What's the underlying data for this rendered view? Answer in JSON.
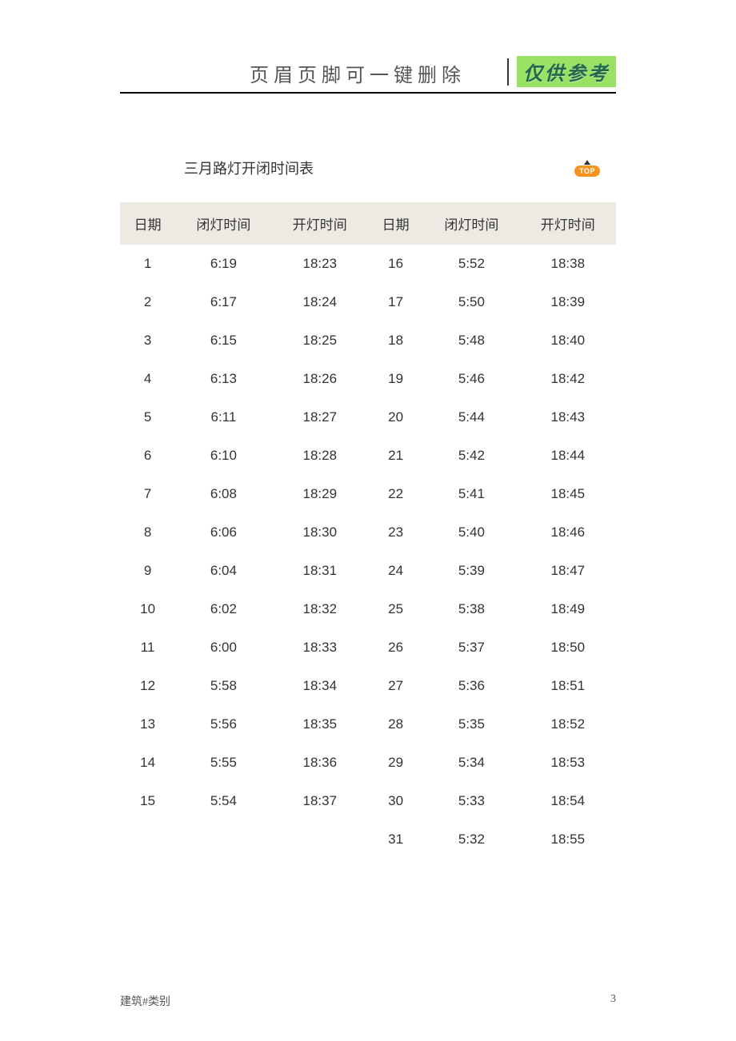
{
  "header": {
    "title": "页眉页脚可一键删除",
    "badge": "仅供参考"
  },
  "heading": "三月路灯开闭时间表",
  "top_icon_label": "TOP",
  "columns": {
    "date_a": "日期",
    "off_a": "闭灯时间",
    "on_a": "开灯时间",
    "date_b": "日期",
    "off_b": "闭灯时间",
    "on_b": "开灯时间"
  },
  "footer": {
    "left": "建筑#类别",
    "right": "3"
  },
  "chart_data": {
    "type": "table",
    "title": "三月路灯开闭时间表",
    "columns": [
      "日期",
      "闭灯时间",
      "开灯时间",
      "日期",
      "闭灯时间",
      "开灯时间"
    ],
    "rows": [
      [
        "1",
        "6:19",
        "18:23",
        "16",
        "5:52",
        "18:38"
      ],
      [
        "2",
        "6:17",
        "18:24",
        "17",
        "5:50",
        "18:39"
      ],
      [
        "3",
        "6:15",
        "18:25",
        "18",
        "5:48",
        "18:40"
      ],
      [
        "4",
        "6:13",
        "18:26",
        "19",
        "5:46",
        "18:42"
      ],
      [
        "5",
        "6:11",
        "18:27",
        "20",
        "5:44",
        "18:43"
      ],
      [
        "6",
        "6:10",
        "18:28",
        "21",
        "5:42",
        "18:44"
      ],
      [
        "7",
        "6:08",
        "18:29",
        "22",
        "5:41",
        "18:45"
      ],
      [
        "8",
        "6:06",
        "18:30",
        "23",
        "5:40",
        "18:46"
      ],
      [
        "9",
        "6:04",
        "18:31",
        "24",
        "5:39",
        "18:47"
      ],
      [
        "10",
        "6:02",
        "18:32",
        "25",
        "5:38",
        "18:49"
      ],
      [
        "11",
        "6:00",
        "18:33",
        "26",
        "5:37",
        "18:50"
      ],
      [
        "12",
        "5:58",
        "18:34",
        "27",
        "5:36",
        "18:51"
      ],
      [
        "13",
        "5:56",
        "18:35",
        "28",
        "5:35",
        "18:52"
      ],
      [
        "14",
        "5:55",
        "18:36",
        "29",
        "5:34",
        "18:53"
      ],
      [
        "15",
        "5:54",
        "18:37",
        "30",
        "5:33",
        "18:54"
      ],
      [
        "",
        "",
        "",
        "31",
        "5:32",
        "18:55"
      ]
    ]
  }
}
